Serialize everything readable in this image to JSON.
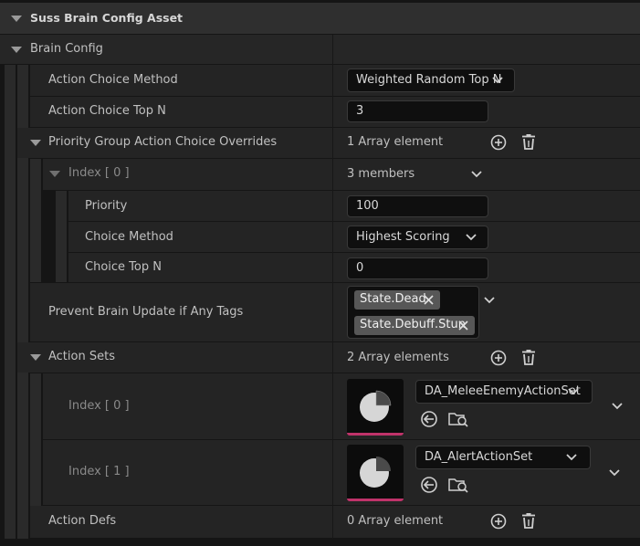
{
  "header": {
    "title": "Suss Brain Config Asset"
  },
  "brain_config": {
    "label": "Brain Config"
  },
  "action_choice_method": {
    "label": "Action Choice Method",
    "value": "Weighted Random Top N"
  },
  "action_choice_top_n": {
    "label": "Action Choice Top N",
    "value": "3"
  },
  "priority_overrides": {
    "label": "Priority Group Action Choice Overrides",
    "count": "1 Array element",
    "index0": {
      "label": "Index [ 0 ]",
      "members": "3 members",
      "priority": {
        "label": "Priority",
        "value": "100"
      },
      "choice_method": {
        "label": "Choice Method",
        "value": "Highest Scoring"
      },
      "choice_top_n": {
        "label": "Choice Top N",
        "value": "0"
      }
    }
  },
  "prevent_update": {
    "label": "Prevent Brain Update if Any Tags",
    "tags": [
      "State.Dead",
      "State.Debuff.Stun"
    ]
  },
  "action_sets": {
    "label": "Action Sets",
    "count": "2 Array elements",
    "items": [
      {
        "index_label": "Index [ 0 ]",
        "asset": "DA_MeleeEnemyActionSet"
      },
      {
        "index_label": "Index [ 1 ]",
        "asset": "DA_AlertActionSet"
      }
    ]
  },
  "action_defs": {
    "label": "Action Defs",
    "count": "0 Array element"
  },
  "colors": {
    "panel_bg": "#242424",
    "header_bg": "#2f2f2f",
    "field_bg": "#0f0f0f",
    "tag_bg": "#575757",
    "thumb_accent": "#c0336a"
  }
}
